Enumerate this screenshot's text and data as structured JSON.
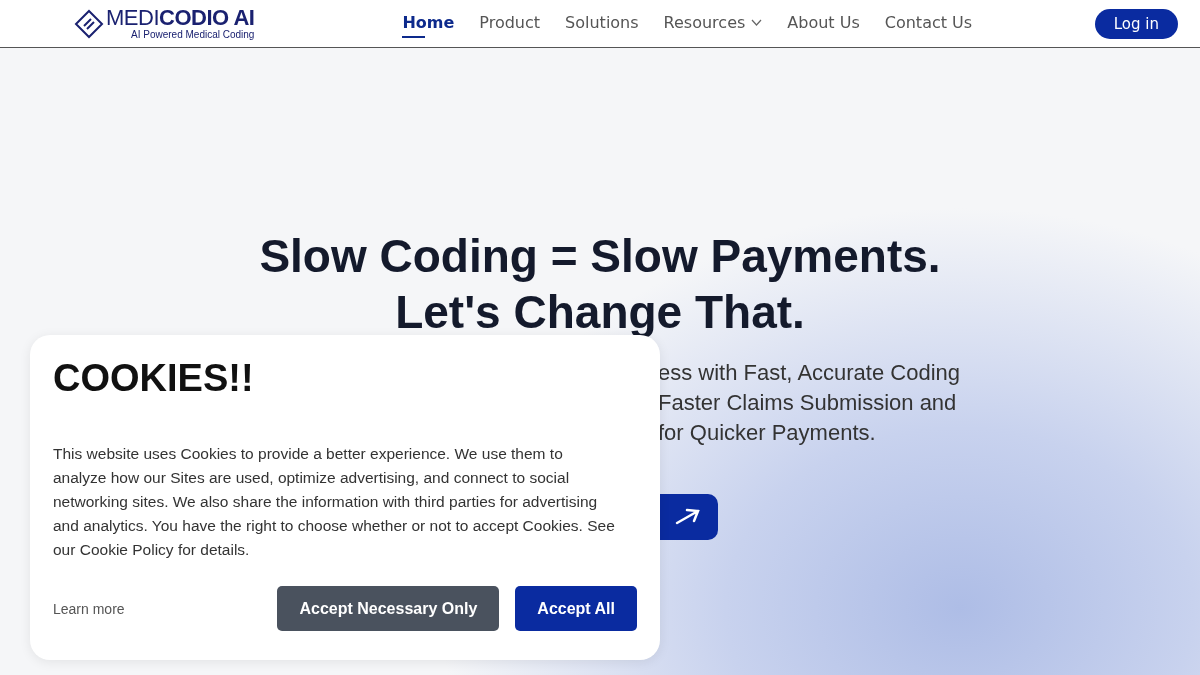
{
  "header": {
    "logo": {
      "name": "MEDI**CODIO AI**",
      "tagline": "AI Powered Medical Coding"
    },
    "nav": [
      {
        "label": "Home",
        "selected": true,
        "dropdown": false
      },
      {
        "label": "Product",
        "selected": false,
        "dropdown": false
      },
      {
        "label": "Solutions",
        "selected": false,
        "dropdown": false
      },
      {
        "label": "Resources",
        "selected": false,
        "dropdown": true
      },
      {
        "label": "About Us",
        "selected": false,
        "dropdown": false
      },
      {
        "label": "Contact Us",
        "selected": false,
        "dropdown": false
      }
    ],
    "login_button": "Log in"
  },
  "hero": {
    "title_lines": [
      "Slow Coding = Slow Payments.",
      "Let's Change That."
    ],
    "subtitle_visible_lines": [
      "ess with Fast, Accurate Coding",
      "Faster Claims Submission and",
      "for Quicker Payments."
    ]
  },
  "cookie_banner": {
    "title": "COOKIES!!",
    "text": "This website uses Cookies to provide a better experience. We use them to analyze how our Sites are used, optimize advertising, and connect to social networking sites. We also share the information with third parties for advertising and analytics. You have the right to choose whether or not to accept Cookies. See our Cookie Policy for details.",
    "learn_more": "Learn more",
    "buttons": [
      {
        "label": "Accept Necessary Only",
        "kind": "secondary"
      },
      {
        "label": "Accept All",
        "kind": "primary"
      }
    ]
  }
}
